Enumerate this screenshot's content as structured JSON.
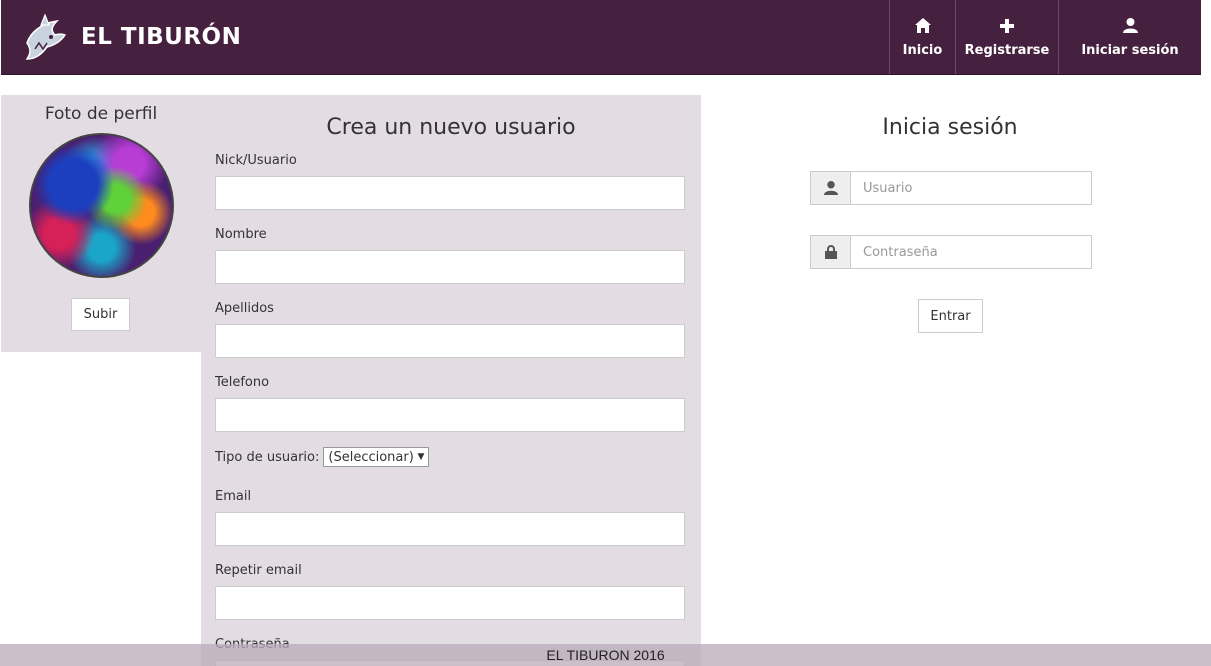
{
  "header": {
    "brand": "EL TIBURÓN",
    "nav": [
      {
        "label": "Inicio",
        "icon": "home-icon"
      },
      {
        "label": "Registrarse",
        "icon": "plus-icon"
      },
      {
        "label": "Iniciar sesión",
        "icon": "user-icon"
      }
    ],
    "background_color": "#46203f"
  },
  "profile_photo": {
    "title": "Foto de perfil",
    "upload_label": "Subir"
  },
  "register": {
    "title": "Crea un nuevo usuario",
    "fields": [
      {
        "label": "Nick/Usuario",
        "value": ""
      },
      {
        "label": "Nombre",
        "value": ""
      },
      {
        "label": "Apellidos",
        "value": ""
      },
      {
        "label": "Telefono",
        "value": ""
      },
      {
        "label": "Email",
        "value": ""
      },
      {
        "label": "Repetir email",
        "value": ""
      },
      {
        "label": "Contraseña",
        "value": ""
      }
    ],
    "user_type": {
      "label": "Tipo de usuario:",
      "selected": "(Seleccionar)"
    }
  },
  "login": {
    "title": "Inicia sesión",
    "username_placeholder": "Usuario",
    "password_placeholder": "Contraseña",
    "submit_label": "Entrar"
  },
  "footer": {
    "text": "EL TIBURON 2016"
  }
}
